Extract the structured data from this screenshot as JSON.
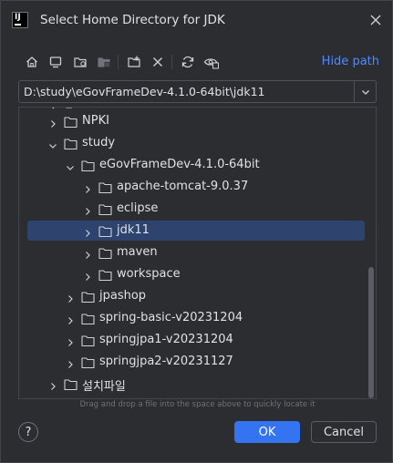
{
  "window": {
    "title": "Select Home Directory for JDK",
    "logo_text": "IJ"
  },
  "toolbar": {
    "icons": [
      "home-icon",
      "desktop-icon",
      "project-folder-icon",
      "module-folder-icon",
      "new-folder-icon",
      "delete-icon",
      "refresh-icon",
      "show-hidden-icon"
    ],
    "hide_path_label": "Hide path"
  },
  "path": {
    "value": "D:\\study\\eGovFrameDev-4.1.0-64bit\\jdk11"
  },
  "tree": {
    "items": [
      {
        "label": "NPKI",
        "expanded": false,
        "selected": false
      },
      {
        "label": "study",
        "expanded": true,
        "selected": false
      },
      {
        "label": "eGovFrameDev-4.1.0-64bit",
        "expanded": true,
        "selected": false
      },
      {
        "label": "apache-tomcat-9.0.37",
        "expanded": false,
        "selected": false
      },
      {
        "label": "eclipse",
        "expanded": false,
        "selected": false
      },
      {
        "label": "jdk11",
        "expanded": false,
        "selected": true
      },
      {
        "label": "maven",
        "expanded": false,
        "selected": false
      },
      {
        "label": "workspace",
        "expanded": false,
        "selected": false
      },
      {
        "label": "jpashop",
        "expanded": false,
        "selected": false
      },
      {
        "label": "spring-basic-v20231204",
        "expanded": false,
        "selected": false
      },
      {
        "label": "springjpa1-v20231204",
        "expanded": false,
        "selected": false
      },
      {
        "label": "springjpa2-v20231127",
        "expanded": false,
        "selected": false
      },
      {
        "label": "설치파일",
        "expanded": false,
        "selected": false
      }
    ]
  },
  "hint": {
    "text": "Drag and drop a file into the space above to quickly locate it"
  },
  "footer": {
    "help_label": "?",
    "ok_label": "OK",
    "cancel_label": "Cancel"
  },
  "colors": {
    "accent": "#3574f0",
    "link": "#548af7",
    "selection": "#2e436e",
    "background": "#2b2d30"
  }
}
